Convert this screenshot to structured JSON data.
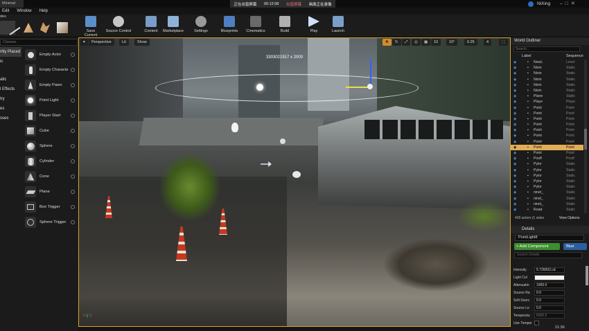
{
  "window": {
    "tab": "Minimal",
    "title": "NiXing"
  },
  "recording": {
    "status": "正在出窗屏幕",
    "time": "00:12:08",
    "hint1": "出窗屏幕",
    "hint2": "画面正在录像"
  },
  "menu": [
    "Edit",
    "Window",
    "Help"
  ],
  "modes_label": "des",
  "toolbar": [
    {
      "label": "Save Current",
      "icon": "save-icon"
    },
    {
      "label": "Source Control",
      "icon": "source-control-icon"
    },
    {
      "label": "Content",
      "icon": "content-icon"
    },
    {
      "label": "Marketplace",
      "icon": "marketplace-icon"
    },
    {
      "label": "Settings",
      "icon": "settings-icon"
    },
    {
      "label": "Blueprints",
      "icon": "blueprints-icon"
    },
    {
      "label": "Cinematics",
      "icon": "cinematics-icon"
    },
    {
      "label": "Build",
      "icon": "build-icon"
    },
    {
      "label": "Play",
      "icon": "play-icon"
    },
    {
      "label": "Launch",
      "icon": "launch-icon"
    }
  ],
  "left": {
    "search_placeholder": "Classes",
    "categories": [
      "ntly Placed",
      "ic",
      "atic",
      "l Effects",
      "try",
      "es",
      "sses"
    ],
    "items": [
      "Empty Actor",
      "Empty Characte",
      "Empty Pawn",
      "Point Light",
      "Player Start",
      "Cube",
      "Sphere",
      "Cylinder",
      "Cone",
      "Plane",
      "Box Trigger",
      "Sphere Trigger"
    ]
  },
  "viewport": {
    "perspective": "Perspective",
    "lit": "Lit",
    "show": "Show",
    "coords": "3303021917 x 2000",
    "snap_values": [
      "10",
      "10°",
      "0.25",
      "4"
    ]
  },
  "outliner": {
    "title": "World Outliner",
    "search_placeholder": "Search...",
    "col_label": "Label",
    "col_type": "Sequence",
    "rows": [
      [
        "NewL",
        "Level"
      ],
      [
        "Nixin",
        "Static"
      ],
      [
        "Nixin",
        "Static"
      ],
      [
        "Nixin",
        "Static"
      ],
      [
        "Nixin",
        "Static"
      ],
      [
        "Nixin",
        "Static"
      ],
      [
        "Plane",
        "Static"
      ],
      [
        "Playe",
        "Playe"
      ],
      [
        "Point",
        "Point"
      ],
      [
        "Point",
        "Point"
      ],
      [
        "Point",
        "Point"
      ],
      [
        "Point",
        "Point"
      ],
      [
        "Point",
        "Point"
      ],
      [
        "Point",
        "Point"
      ],
      [
        "Point",
        "Point"
      ],
      [
        "Point",
        "Point"
      ],
      [
        "Point",
        "Point"
      ],
      [
        "Postf",
        "Postf"
      ],
      [
        "Pylor",
        "Static"
      ],
      [
        "Pylor",
        "Static"
      ],
      [
        "Pylor",
        "Static"
      ],
      [
        "Pylor",
        "Static"
      ],
      [
        "Pylor",
        "Static"
      ],
      [
        "ninet_",
        "Static"
      ],
      [
        "ninet_",
        "Static"
      ],
      [
        "ninet_",
        "Static"
      ],
      [
        "Road",
        "Static"
      ]
    ],
    "selected_index": 15,
    "footer": "429 actors (1 selec",
    "view_options": "View Options"
  },
  "details": {
    "title": "Details",
    "name": "PointLight8",
    "add_component": "+ Add Component",
    "blueprint": "Blue",
    "search_placeholder": "Search Details",
    "props": [
      [
        "Intensity",
        "5.726002.cd"
      ],
      [
        "Light Col",
        ""
      ],
      [
        "Attenuatio",
        "1000.0"
      ],
      [
        "Source Ra",
        "0.0"
      ],
      [
        "Soft Sourc",
        "0.0"
      ],
      [
        "Source Le",
        "0.0"
      ],
      [
        "Temperatu",
        "6500.0"
      ],
      [
        "Use Temper",
        ""
      ]
    ]
  },
  "clock": "21:36"
}
